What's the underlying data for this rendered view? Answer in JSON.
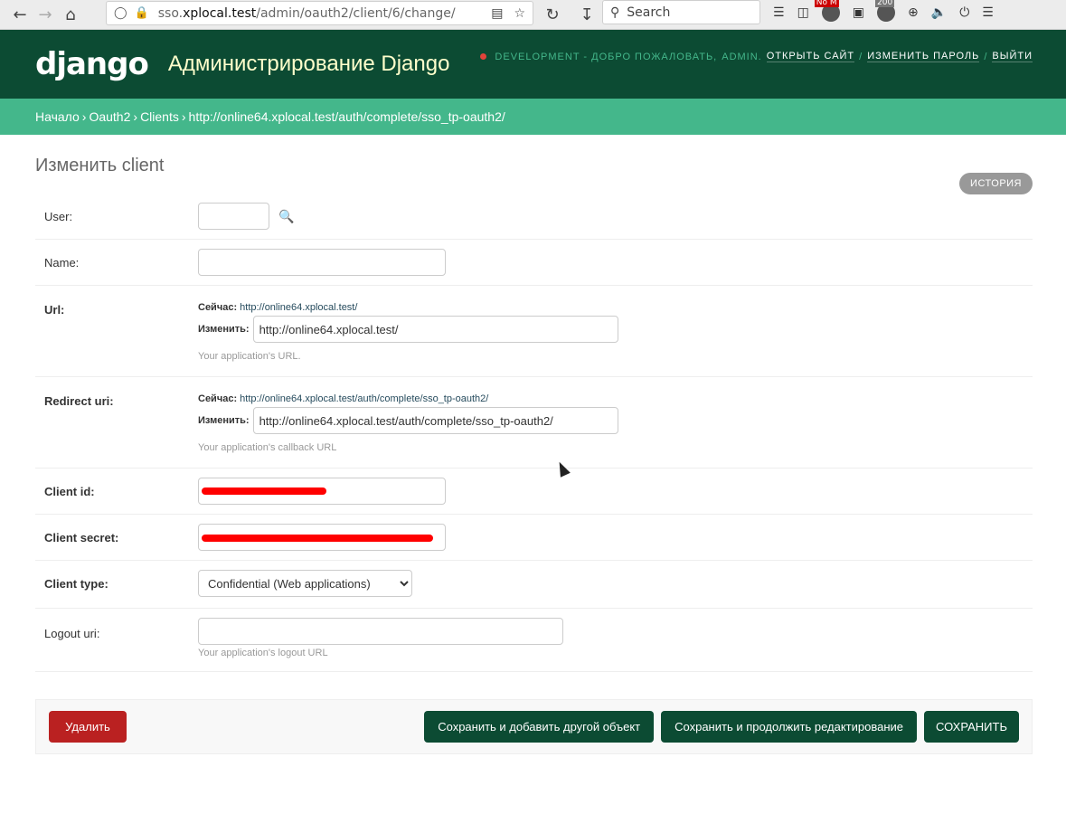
{
  "browser": {
    "url_prefix": "sso.",
    "url_host": "xplocal.test",
    "url_path": "/admin/oauth2/client/6/change/",
    "search_placeholder": "Search",
    "ext_badge_1": "No M",
    "ext_badge_2": "200"
  },
  "header": {
    "logo": "django",
    "title": "Администрирование Django",
    "env": "DEVELOPMENT - ДОБРО ПОЖАЛОВАТЬ,",
    "user": "ADMIN.",
    "open_site": "ОТКРЫТЬ САЙТ",
    "change_password": "ИЗМЕНИТЬ ПАРОЛЬ",
    "logout": "ВЫЙТИ"
  },
  "breadcrumbs": [
    "Начало",
    "Oauth2",
    "Clients",
    "http://online64.xplocal.test/auth/complete/sso_tp-oauth2/"
  ],
  "page": {
    "title": "Изменить client",
    "history": "ИСТОРИЯ"
  },
  "form": {
    "user_label": "User:",
    "user_value": "",
    "name_label": "Name:",
    "name_value": "",
    "url_label": "Url:",
    "url_current_label": "Сейчас:",
    "url_current": "http://online64.xplocal.test/",
    "url_change_label": "Изменить:",
    "url_value": "http://online64.xplocal.test/",
    "url_help": "Your application's URL.",
    "redirect_label": "Redirect uri:",
    "redirect_current_label": "Сейчас:",
    "redirect_current": "http://online64.xplocal.test/auth/complete/sso_tp-oauth2/",
    "redirect_change_label": "Изменить:",
    "redirect_value": "http://online64.xplocal.test/auth/complete/sso_tp-oauth2/",
    "redirect_help": "Your application's callback URL",
    "client_id_label": "Client id:",
    "client_secret_label": "Client secret:",
    "client_type_label": "Client type:",
    "client_type_value": "Confidential (Web applications)",
    "logout_label": "Logout uri:",
    "logout_value": "",
    "logout_help": "Your application's logout URL"
  },
  "actions": {
    "delete": "Удалить",
    "save_add": "Сохранить и добавить другой объект",
    "save_continue": "Сохранить и продолжить редактирование",
    "save": "СОХРАНИТЬ"
  },
  "colors": {
    "header": "#0c4b33",
    "breadcrumbs": "#44b78b",
    "delete": "#ba2121",
    "title_accent": "#f5dd5d"
  }
}
